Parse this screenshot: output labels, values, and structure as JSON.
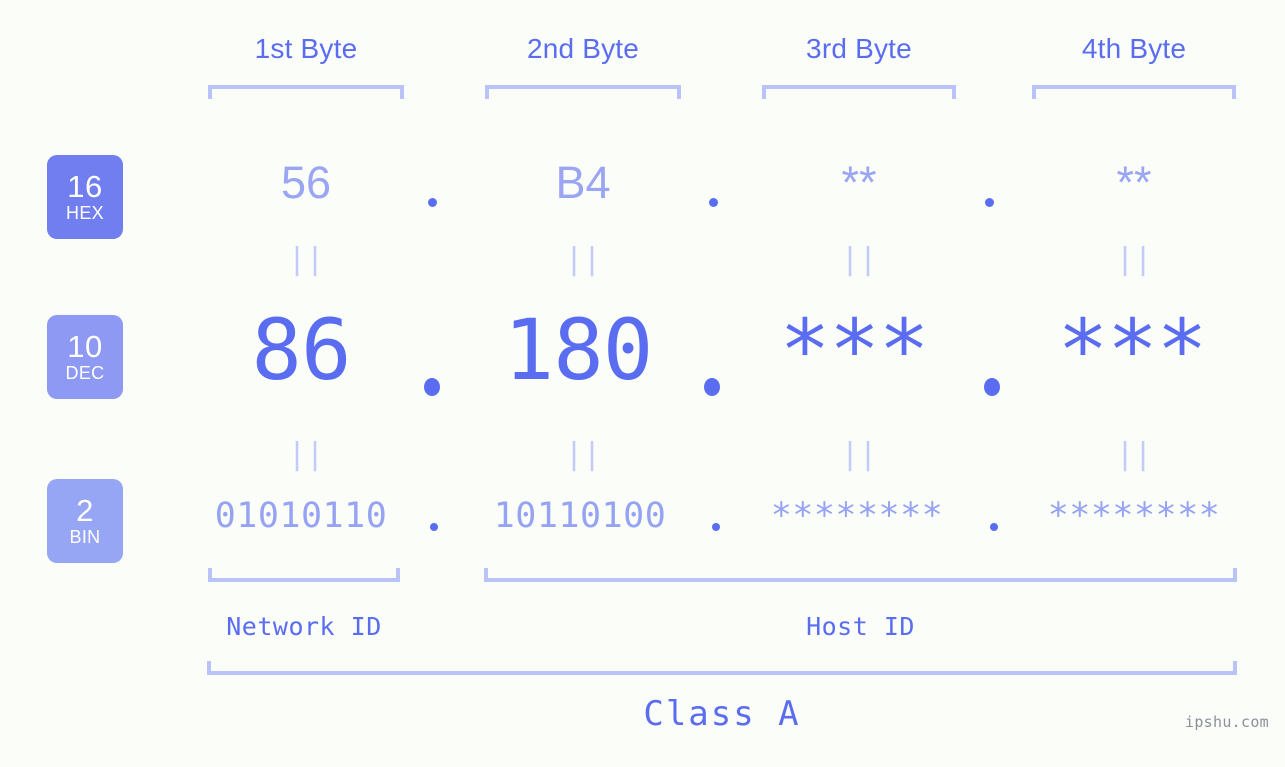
{
  "meta": {
    "background_color": "#fbfdf9",
    "accent_color": "#5a6df0",
    "accent_light_color": "#9aa6f3",
    "bracket_color": "#b9c3f7",
    "watermark_color": "#8b9099"
  },
  "watermark": "ipshu.com",
  "byte_headers": [
    {
      "label": "1st Byte"
    },
    {
      "label": "2nd Byte"
    },
    {
      "label": "3rd Byte"
    },
    {
      "label": "4th Byte"
    }
  ],
  "radix_rows": [
    {
      "key": "hex",
      "base": "16",
      "name": "HEX",
      "badge_color": "#707ef0",
      "values": [
        "56",
        "B4",
        "**",
        "**"
      ],
      "separator": "."
    },
    {
      "key": "dec",
      "base": "10",
      "name": "DEC",
      "badge_color": "#8d99f2",
      "values": [
        "86",
        "180",
        "***",
        "***"
      ],
      "separator": "."
    },
    {
      "key": "bin",
      "base": "2",
      "name": "BIN",
      "badge_color": "#96a6f5",
      "values": [
        "01010110",
        "10110100",
        "********",
        "********"
      ],
      "separator": "."
    }
  ],
  "equals_connectors": {
    "glyph": "||",
    "rows": [
      "hex-to-dec",
      "dec-to-bin"
    ],
    "count_per_row": 4
  },
  "id_sections": [
    {
      "key": "network",
      "label": "Network ID"
    },
    {
      "key": "host",
      "label": "Host ID"
    }
  ],
  "class_section": {
    "label": "Class A"
  }
}
